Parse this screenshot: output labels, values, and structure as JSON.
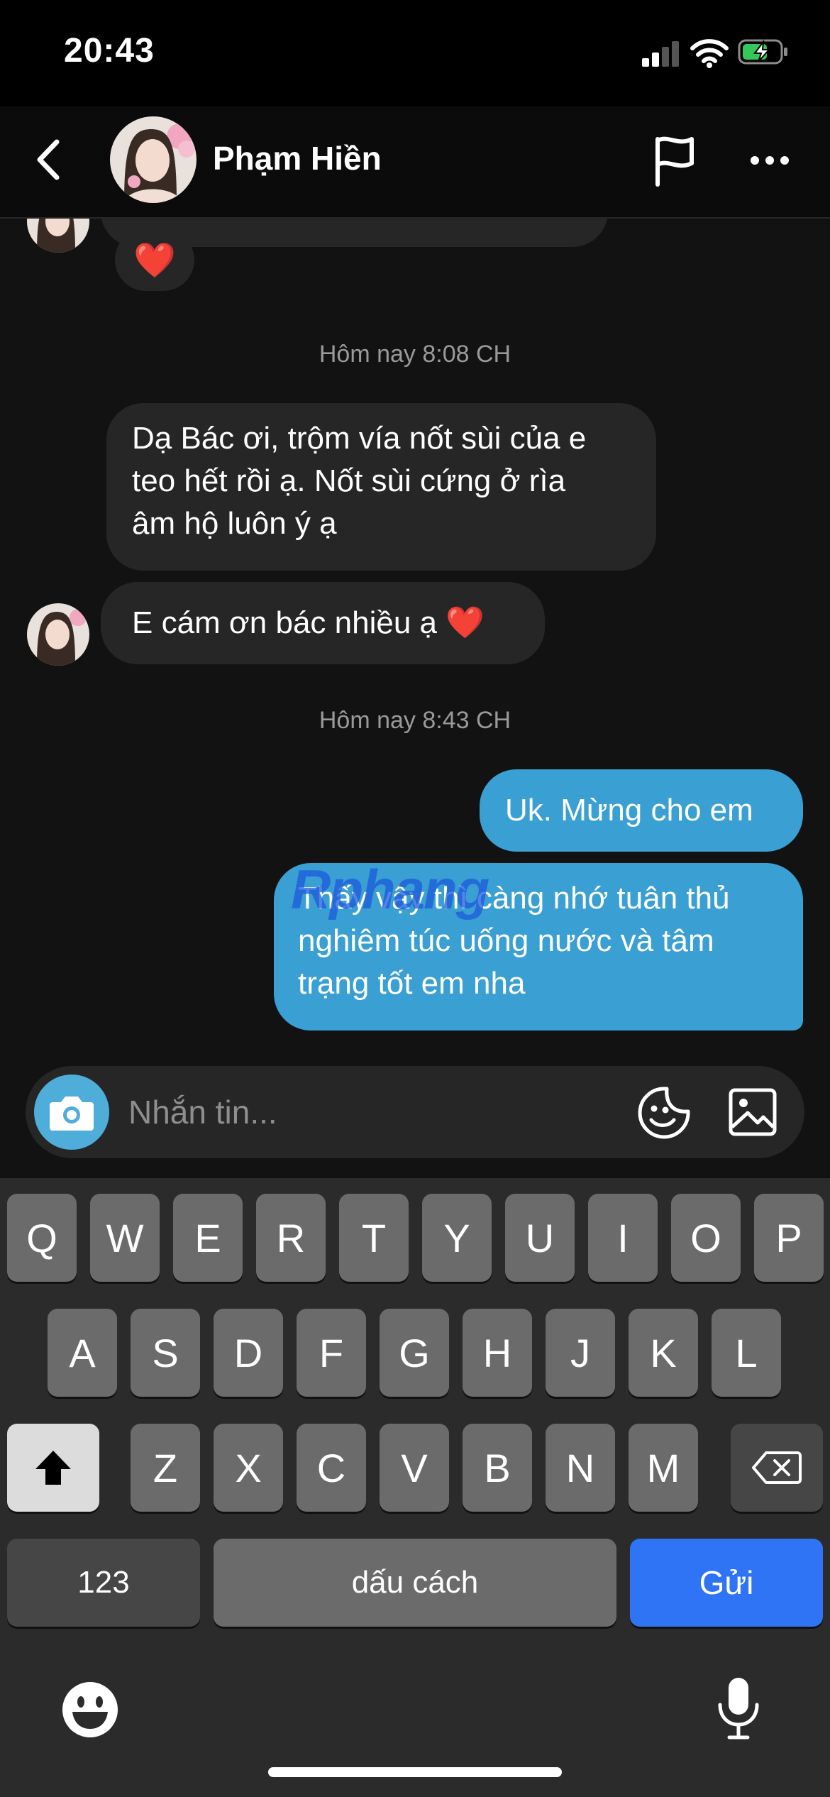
{
  "status_bar": {
    "time": "20:43"
  },
  "header": {
    "contact_name": "Phạm Hiền"
  },
  "chat": {
    "reaction_emoji": "❤️",
    "timestamp_1": "Hôm nay 8:08 CH",
    "incoming_1_lines": [
      "Dạ Bác ơi, trộm vía nốt sùi của e",
      "teo hết rồi ạ. Nốt sùi cứng ở rìa",
      "âm hộ luôn ý ạ"
    ],
    "incoming_2": "E cám ơn bác nhiều ạ ❤️",
    "timestamp_2": "Hôm nay 8:43 CH",
    "outgoing_1": "Uk. Mừng cho em",
    "outgoing_2_lines": [
      "Thấy vậy thì càng nhớ tuân thủ",
      "nghiêm túc uống nước và tâm",
      "trạng tốt em nha"
    ],
    "watermark": "Rphang"
  },
  "composer": {
    "placeholder": "Nhắn tin..."
  },
  "keyboard": {
    "row1": [
      "Q",
      "W",
      "E",
      "R",
      "T",
      "Y",
      "U",
      "I",
      "O",
      "P"
    ],
    "row2": [
      "A",
      "S",
      "D",
      "F",
      "G",
      "H",
      "J",
      "K",
      "L"
    ],
    "row3": [
      "Z",
      "X",
      "C",
      "V",
      "B",
      "N",
      "M"
    ],
    "numbers_key": "123",
    "space_key": "dấu cách",
    "send_key": "Gửi"
  },
  "colors": {
    "outgoing_bubble": "#3a9fd2",
    "incoming_bubble": "#262626",
    "camera_button": "#4eaed9",
    "send_key": "#2f74f5"
  }
}
